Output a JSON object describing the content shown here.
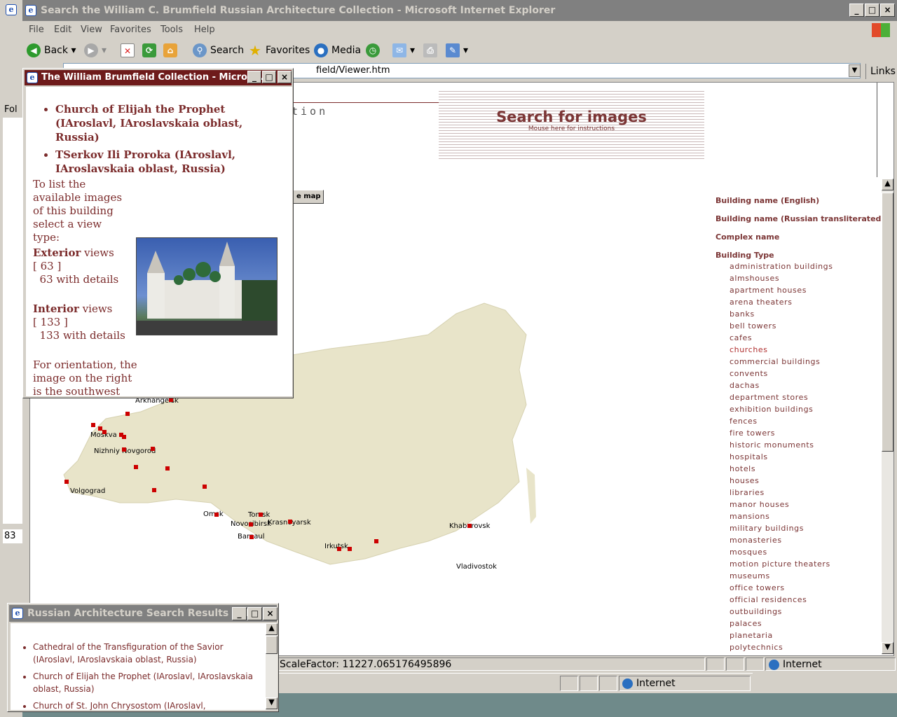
{
  "window": {
    "title": "Search the William C. Brumfield Russian Architecture Collection - Microsoft Internet Explorer",
    "menu": [
      "File",
      "Edit",
      "View",
      "Favorites",
      "Tools",
      "Help"
    ]
  },
  "toolbar": {
    "back": "Back",
    "search": "Search",
    "favorites": "Favorites",
    "media": "Media"
  },
  "address": {
    "value": "field/Viewer.htm",
    "links_label": "Links"
  },
  "left_pane": {
    "fol": "Fol",
    "num": "83"
  },
  "page": {
    "heading_fragment": "tion",
    "search_banner": {
      "title": "Search for images",
      "subtitle": "Mouse here for instructions"
    },
    "map_button": "e map",
    "cities": [
      {
        "name": "Arkhangelsk"
      },
      {
        "name": "Moskva"
      },
      {
        "name": "Nizhniy Novgorod"
      },
      {
        "name": "Volgograd"
      },
      {
        "name": "Omsk"
      },
      {
        "name": "Tomsk"
      },
      {
        "name": "Novosibirsk"
      },
      {
        "name": "Krasnoyarsk"
      },
      {
        "name": "Barnaul"
      },
      {
        "name": "Irkutsk"
      },
      {
        "name": "Khabarovsk"
      },
      {
        "name": "Vladivostok"
      }
    ],
    "sidebar": {
      "h1": "Building name (English)",
      "h2": "Building name (Russian transliterated)",
      "h3": "Complex name",
      "h4": "Building Type",
      "types": [
        "administration buildings",
        "almshouses",
        "apartment houses",
        "arena theaters",
        "banks",
        "bell towers",
        "cafes",
        "churches",
        "commercial buildings",
        "convents",
        "dachas",
        "department stores",
        "exhibition buildings",
        "fences",
        "fire towers",
        "historic monuments",
        "hospitals",
        "hotels",
        "houses",
        "libraries",
        "manor houses",
        "mansions",
        "military buildings",
        "monasteries",
        "mosques",
        "motion picture theaters",
        "museums",
        "office towers",
        "official residences",
        "outbuildings",
        "palaces",
        "planetaria",
        "polytechnics"
      ]
    }
  },
  "status": {
    "scale": "ScaleFactor: 11227.065176495896",
    "zone": "Internet"
  },
  "popup": {
    "title": "The William Brumfield Collection - Micros...",
    "items": [
      "Church of Elijah the Prophet (IAroslavl, IAroslavskaia oblast, Russia)",
      "TSerkov Ili Proroka (IAroslavl, IAroslavskaia oblast, Russia)"
    ],
    "instr": "To list the available images of this building select a view type:",
    "ext_label": "Exterior",
    "views": "views",
    "ext_count": "[ 63 ]",
    "ext_details": "63 with details",
    "int_label": "Interior",
    "int_count": "[ 133 ]",
    "int_details": "133 with details",
    "orient": "For orientation, the image on the right is the southwest view"
  },
  "results": {
    "title": "Russian Architecture Search Results - M...",
    "items": [
      "Cathedral of the Transfiguration of the Savior (IAroslavl, IAroslavskaia oblast, Russia)",
      "Church of Elijah the Prophet (IAroslavl, IAroslavskaia oblast, Russia)",
      "Church of St. John Chrysostom (IAroslavl,"
    ]
  },
  "taskbar": {
    "zone": "Internet"
  },
  "colors": {
    "accent": "#7b2b2b",
    "map_land": "#e8e4c9",
    "marker": "#cc0000"
  }
}
